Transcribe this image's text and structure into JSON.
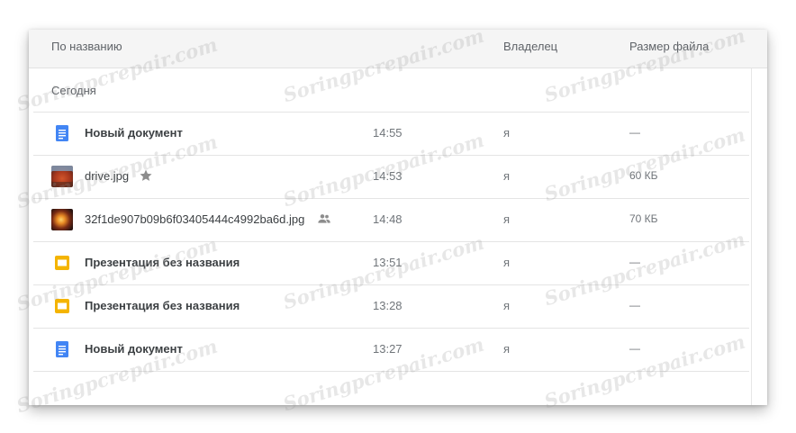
{
  "header": {
    "name_col": "По названию",
    "owner_col": "Владелец",
    "size_col": "Размер файла"
  },
  "section": {
    "label": "Сегодня"
  },
  "files": [
    {
      "name": "Новый документ",
      "type": "doc-icon",
      "time": "14:55",
      "owner": "я",
      "size": "—"
    },
    {
      "name": "drive.jpg",
      "type": "image-thumbnail",
      "badge": "star-icon",
      "time": "14:53",
      "owner": "я",
      "size": "60 КБ"
    },
    {
      "name": "32f1de907b09b6f03405444c4992ba6d.jpg",
      "type": "image-thumbnail",
      "badge": "shared-people-icon",
      "time": "14:48",
      "owner": "я",
      "size": "70 КБ"
    },
    {
      "name": "Презентация без названия",
      "type": "slides-icon",
      "time": "13:51",
      "owner": "я",
      "size": "—"
    },
    {
      "name": "Презентация без названия",
      "type": "slides-icon",
      "time": "13:28",
      "owner": "я",
      "size": "—"
    },
    {
      "name": "Новый документ",
      "type": "doc-icon",
      "time": "13:27",
      "owner": "я",
      "size": "—"
    }
  ],
  "colors": {
    "doc": "#4285f4",
    "slides": "#f4b400",
    "badge": "#8d8d8d"
  },
  "watermark": "Soringpcrepair.com"
}
